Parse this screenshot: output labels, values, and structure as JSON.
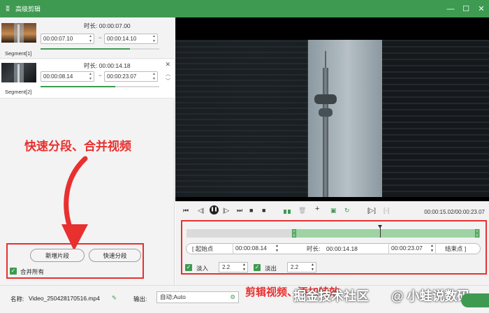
{
  "window": {
    "title": "高级剪辑",
    "logo_glyph": "ʬ"
  },
  "segments": [
    {
      "label": "Segment[1]",
      "duration_label": "时长:",
      "duration": "00:00:07.00",
      "start": "00:00:07.10",
      "end": "00:00:14.10",
      "progress": 0.75
    },
    {
      "label": "Segment[2]",
      "duration_label": "时长:",
      "duration": "00:00:14.18",
      "start": "00:00:08.14",
      "end": "00:00:23.07",
      "progress": 0.63
    }
  ],
  "annotations": {
    "left": "快速分段、合并视频",
    "bottom": "剪辑视频、添加特效",
    "watermark1": "掘金技术社区",
    "watermark2": "@ 小蛙说数码"
  },
  "segment_actions": {
    "new_segment": "新增片段",
    "quick_split": "快速分段",
    "merge_all": "合并所有",
    "merge_all_checked": true
  },
  "player": {
    "current_time": "00:00:15.02/00:00:23.07"
  },
  "trim": {
    "start_button": "[ 起始点",
    "start_time": "00:00:08.14",
    "duration_label": "时长:",
    "duration": "00:00:14.18",
    "end_time": "00:00:23.07",
    "end_button": "结束点 ]",
    "selection_start": 0.36,
    "selection_end": 1.0,
    "playhead": 0.66
  },
  "fades": {
    "fade_in_label": "淡入",
    "fade_in_value": "2.2",
    "fade_in_checked": true,
    "fade_out_label": "淡出",
    "fade_out_value": "2.2",
    "fade_out_checked": true
  },
  "bottom": {
    "name_label": "名称:",
    "filename": "Video_250428170516.mp4",
    "output_label": "输出:",
    "output_value": "自动;Auto"
  },
  "colors": {
    "accent": "#3e9a51",
    "annotation": "#e8302f"
  },
  "icons": [
    "skip-start-icon",
    "step-back-icon",
    "pause-icon",
    "step-forward-icon",
    "stop-icon",
    "record-icon",
    "split-icon",
    "delete-icon",
    "add-icon",
    "copy-icon",
    "reset-icon",
    "mark-in-icon",
    "mark-out-icon"
  ]
}
